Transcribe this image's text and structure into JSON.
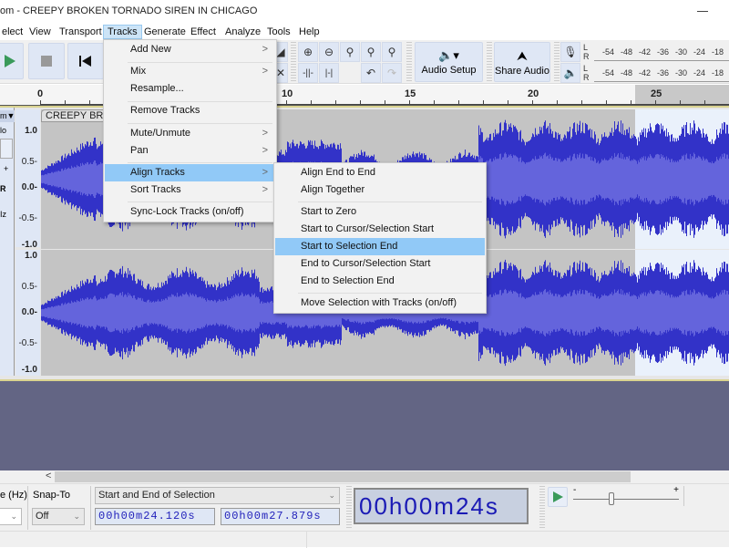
{
  "window": {
    "title": "om - CREEPY BROKEN TORNADO SIREN IN CHICAGO"
  },
  "menubar": {
    "items": [
      {
        "label": "elect",
        "active": false
      },
      {
        "label": "View",
        "active": false
      },
      {
        "label": "Transport",
        "active": false
      },
      {
        "label": "Tracks",
        "active": true
      },
      {
        "label": "Generate",
        "active": false
      },
      {
        "label": "Effect",
        "active": false
      },
      {
        "label": "Analyze",
        "active": false
      },
      {
        "label": "Tools",
        "active": false
      },
      {
        "label": "Help",
        "active": false
      }
    ]
  },
  "toolbar": {
    "transport": [
      "play-icon",
      "stop-icon",
      "skip-to-start-icon"
    ],
    "zoom_tools": [
      "zoom-in-icon",
      "zoom-out-icon",
      "fit-selection-icon",
      "fit-project-icon",
      "zoom-toggle-icon"
    ],
    "edit_tools": [
      "trim-audio-icon",
      "silence-audio-icon",
      "undo-icon",
      "redo-icon"
    ],
    "audio_setup_label": "Audio Setup",
    "share_audio_label": "Share Audio",
    "meter_ticks": [
      "-54",
      "-48",
      "-42",
      "-36",
      "-30",
      "-24",
      "-18"
    ],
    "meter_channels": [
      "L",
      "R"
    ]
  },
  "ruler": {
    "labels": [
      "0",
      "10",
      "15",
      "20",
      "25"
    ]
  },
  "track": {
    "name": "CREEPY BRO",
    "name_menu_suffix": "m",
    "tcp_labels": [
      "lo",
      "+",
      "R",
      "Iz"
    ],
    "vruler_labels": [
      "1.0",
      "0.5-",
      "0.0-",
      "-0.5-",
      "-1.0"
    ],
    "selection_start_s": 24.12,
    "selection_end_s": 27.879
  },
  "tracks_menu": {
    "items": [
      {
        "label": "Add New",
        "submenu": true
      },
      {
        "label": "Mix",
        "submenu": true
      },
      {
        "label": "Resample...",
        "submenu": false
      },
      {
        "label": "Remove Tracks",
        "submenu": false
      },
      {
        "label": "Mute/Unmute",
        "submenu": true
      },
      {
        "label": "Pan",
        "submenu": true
      },
      {
        "label": "Align Tracks",
        "submenu": true,
        "highlighted": true
      },
      {
        "label": "Sort Tracks",
        "submenu": true
      },
      {
        "label": "Sync-Lock Tracks (on/off)",
        "submenu": false
      }
    ],
    "arrow": ">"
  },
  "align_menu": {
    "items": [
      {
        "label": "Align End to End"
      },
      {
        "label": "Align Together"
      },
      {
        "label": "Start to Zero"
      },
      {
        "label": "Start to Cursor/Selection Start"
      },
      {
        "label": "Start to Selection End",
        "highlighted": true
      },
      {
        "label": "End to Cursor/Selection Start"
      },
      {
        "label": "End to Selection End"
      },
      {
        "label": "Move Selection with Tracks (on/off)"
      }
    ]
  },
  "selection_toolbar": {
    "rate_label": "e (Hz)",
    "snap_label": "Snap-To",
    "snap_value": "Off",
    "mode_value": "Start and End of Selection",
    "start_time": "00h00m24.120s",
    "end_time": "00h00m27.879s",
    "big_time": "00h00m24s",
    "scroll_left": "<"
  },
  "play_at_speed": {
    "minus": "-",
    "plus": "+",
    "speed_fraction": 0.35
  },
  "colors": {
    "waveform": "#3232c8",
    "waveform_rms": "#6464dc",
    "selection_bg": "#eaf1fb",
    "menu_highlight": "#91c9f7",
    "timeline_empty": "#636584"
  }
}
